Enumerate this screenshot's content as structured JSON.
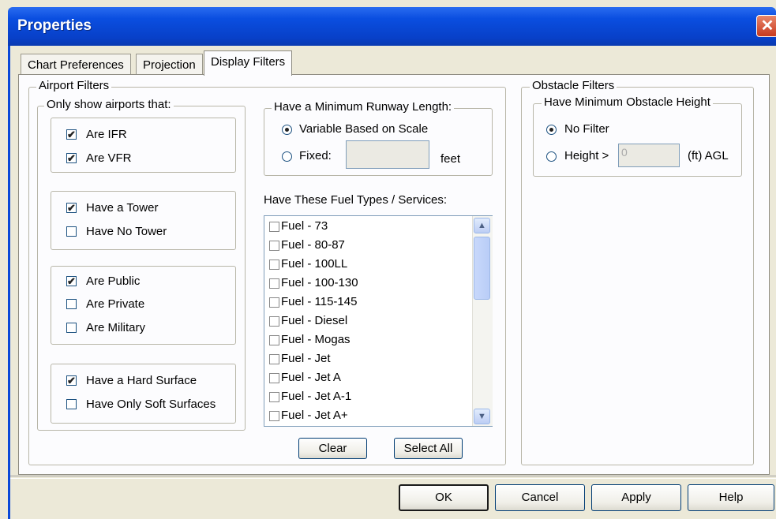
{
  "window": {
    "title": "Properties",
    "close_symbol": "✕"
  },
  "tabs": [
    {
      "label": "Chart Preferences",
      "active": false
    },
    {
      "label": "Projection",
      "active": false
    },
    {
      "label": "Display Filters",
      "active": true
    }
  ],
  "airport_filters": {
    "title": "Airport Filters",
    "only_show": {
      "title": "Only show airports that:",
      "groups": [
        [
          {
            "label": "Are IFR",
            "checked": true
          },
          {
            "label": "Are VFR",
            "checked": true
          }
        ],
        [
          {
            "label": "Have a Tower",
            "checked": true
          },
          {
            "label": "Have No Tower",
            "checked": false
          }
        ],
        [
          {
            "label": "Are Public",
            "checked": true
          },
          {
            "label": "Are Private",
            "checked": false
          },
          {
            "label": "Are Military",
            "checked": false
          }
        ],
        [
          {
            "label": "Have a Hard Surface",
            "checked": true
          },
          {
            "label": "Have Only Soft Surfaces",
            "checked": false
          }
        ]
      ]
    },
    "runway": {
      "title": "Have a Minimum Runway Length:",
      "variable_label": "Variable Based on Scale",
      "variable_selected": true,
      "fixed_label": "Fixed:",
      "fixed_selected": false,
      "fixed_value": "",
      "unit": "feet"
    },
    "fuel": {
      "title": "Have These Fuel Types / Services:",
      "items": [
        {
          "label": "Fuel - 73",
          "checked": false
        },
        {
          "label": "Fuel - 80-87",
          "checked": false
        },
        {
          "label": "Fuel - 100LL",
          "checked": false
        },
        {
          "label": "Fuel - 100-130",
          "checked": false
        },
        {
          "label": "Fuel - 115-145",
          "checked": false
        },
        {
          "label": "Fuel - Diesel",
          "checked": false
        },
        {
          "label": "Fuel - Mogas",
          "checked": false
        },
        {
          "label": "Fuel - Jet",
          "checked": false
        },
        {
          "label": "Fuel - Jet A",
          "checked": false
        },
        {
          "label": "Fuel - Jet A-1",
          "checked": false
        },
        {
          "label": "Fuel - Jet A+",
          "checked": false
        }
      ],
      "clear_label": "Clear",
      "select_all_label": "Select All"
    }
  },
  "obstacle_filters": {
    "title": "Obstacle Filters",
    "sub_title": "Have Minimum Obstacle Height",
    "no_filter_label": "No Filter",
    "no_filter_selected": true,
    "height_label": "Height >",
    "height_selected": false,
    "height_value": "0",
    "unit": "(ft) AGL"
  },
  "buttons": {
    "ok": "OK",
    "cancel": "Cancel",
    "apply": "Apply",
    "help": "Help"
  },
  "icons": {
    "check": "✔",
    "scroll_up": "▲",
    "scroll_down": "▼"
  }
}
